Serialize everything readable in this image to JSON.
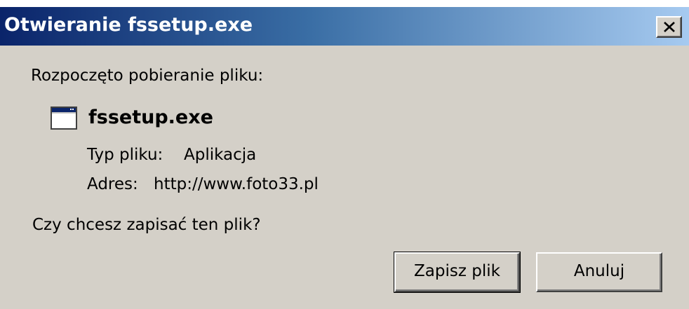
{
  "window": {
    "title": "Otwieranie fssetup.exe",
    "close_label": "×"
  },
  "message": {
    "intro": "Rozpoczęto pobieranie pliku:",
    "question": "Czy chcesz zapisać ten plik?"
  },
  "file": {
    "icon": "application-window-icon",
    "name": "fssetup.exe",
    "type_label": "Typ pliku:",
    "type_value": "Aplikacja",
    "address_label": "Adres:",
    "address_value": "http://www.foto33.pl"
  },
  "buttons": {
    "save_label": "Zapisz plik",
    "cancel_label": "Anuluj"
  },
  "colors": {
    "title_gradient_start": "#0a246a",
    "title_gradient_end": "#a6caf0",
    "dialog_face": "#d4d0c8"
  }
}
